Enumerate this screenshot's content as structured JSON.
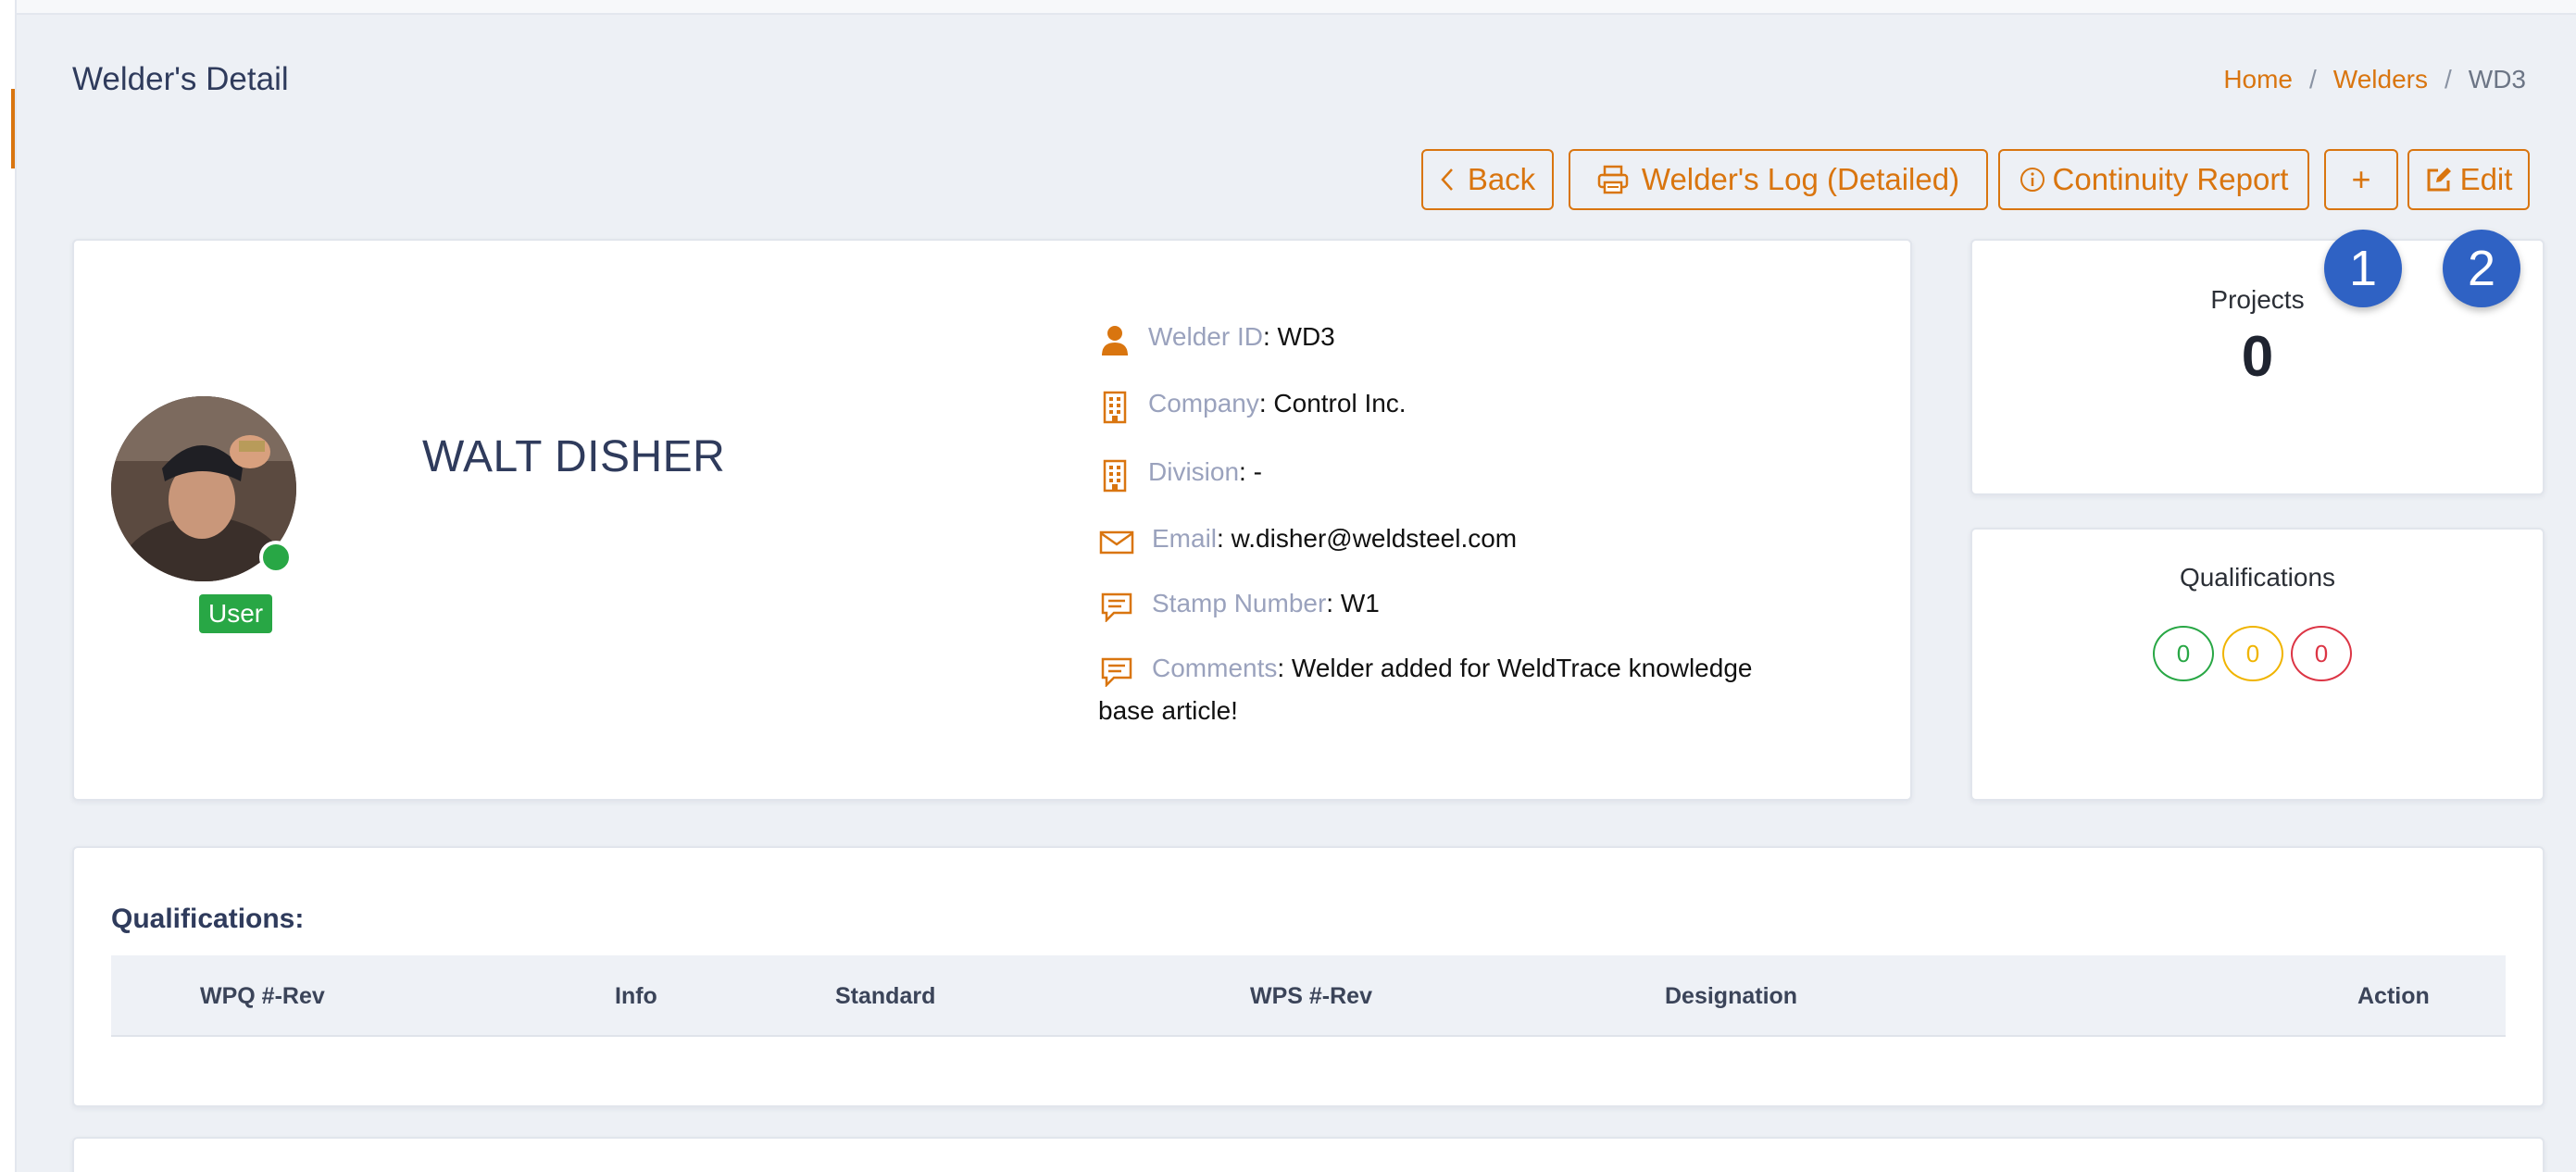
{
  "page": {
    "title": "Welder's Detail"
  },
  "breadcrumb": {
    "home": "Home",
    "welders": "Welders",
    "current": "WD3",
    "separator": "/"
  },
  "toolbar": {
    "back": "Back",
    "log": "Welder's Log (Detailed)",
    "continuity": "Continuity Report",
    "add": "+",
    "edit": "Edit"
  },
  "markers": [
    "1",
    "2"
  ],
  "profile": {
    "name": "WALT DISHER",
    "role": "User",
    "status_color": "#28a745",
    "details": [
      {
        "icon": "user-icon",
        "label": "Welder ID",
        "value": " : WD3"
      },
      {
        "icon": "building-icon",
        "label": "Company",
        "value": " : Control Inc."
      },
      {
        "icon": "building-icon",
        "label": "Division",
        "value": " : -"
      },
      {
        "icon": "envelope-icon",
        "label": "Email",
        "value": " : w.disher@weldsteel.com"
      },
      {
        "icon": "message-icon",
        "label": "Stamp Number",
        "value": " : W1"
      },
      {
        "icon": "message-icon",
        "label": "Comments",
        "value": " : Welder added for WeldTrace knowledge",
        "value_cont": "base article!"
      }
    ]
  },
  "stats": {
    "projects": {
      "title": "Projects",
      "value": "0"
    },
    "qualifications": {
      "title": "Qualifications",
      "counts": [
        {
          "value": "0",
          "color": "#28a745"
        },
        {
          "value": "0",
          "color": "#f0b400"
        },
        {
          "value": "0",
          "color": "#dc3545"
        }
      ]
    }
  },
  "qualifications_table": {
    "title": "Qualifications:",
    "columns": [
      "WPQ #-Rev",
      "Info",
      "Standard",
      "WPS #-Rev",
      "Designation",
      "Action"
    ]
  },
  "colors": {
    "accent": "#d9750f",
    "marker": "#2f62c4",
    "background": "#edf0f5"
  }
}
